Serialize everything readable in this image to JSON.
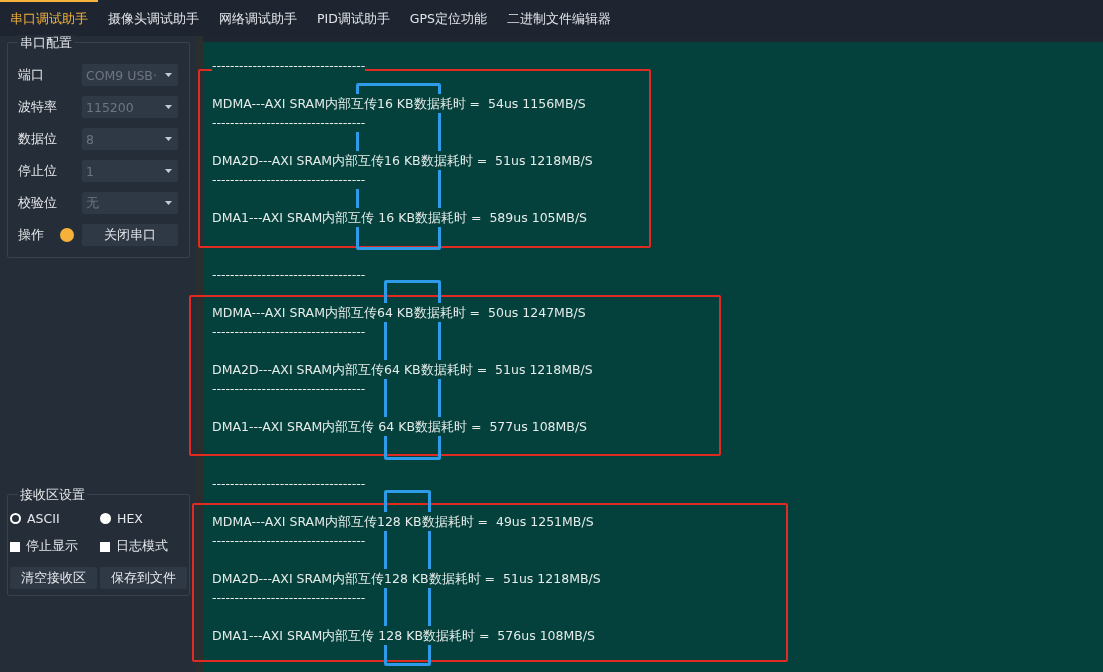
{
  "tabs": [
    {
      "label": "串口调试助手",
      "selected": true
    },
    {
      "label": "摄像头调试助手",
      "selected": false
    },
    {
      "label": "网络调试助手",
      "selected": false
    },
    {
      "label": "PID调试助手",
      "selected": false
    },
    {
      "label": "GPS定位功能",
      "selected": false
    },
    {
      "label": "二进制文件编辑器",
      "selected": false
    }
  ],
  "serial_config": {
    "title": "串口配置",
    "fields": [
      {
        "label": "端口",
        "value": "COM9 USB·",
        "disabled": true
      },
      {
        "label": "波特率",
        "value": "115200",
        "disabled": true
      },
      {
        "label": "数据位",
        "value": "8",
        "disabled": true
      },
      {
        "label": "停止位",
        "value": "1",
        "disabled": true
      },
      {
        "label": "校验位",
        "value": "无",
        "disabled": true
      }
    ],
    "operation": {
      "label": "操作",
      "connected": true,
      "button": "关闭串口"
    }
  },
  "receive_settings": {
    "title": "接收区设置",
    "modes": [
      {
        "label": "ASCII",
        "selected": true
      },
      {
        "label": "HEX",
        "selected": false
      }
    ],
    "options": [
      {
        "label": "停止显示",
        "checked": false
      },
      {
        "label": "日志模式",
        "checked": false
      }
    ],
    "buttons": [
      "清空接收区",
      "保存到文件"
    ]
  },
  "output": {
    "blocks": [
      {
        "entries": [
          {
            "separator": "----------------------------------",
            "text": "MDMA---AXI SRAM内部互传16 KB数据耗时 =  54us 1156MB/S"
          },
          {
            "separator": "----------------------------------",
            "text": "DMA2D---AXI SRAM内部互传16 KB数据耗时 =  51us 1218MB/S"
          },
          {
            "separator": "----------------------------------",
            "text": "DMA1---AXI SRAM内部互传 16 KB数据耗时 =  589us 105MB/S"
          }
        ]
      },
      {
        "entries": [
          {
            "separator": "----------------------------------",
            "text": "MDMA---AXI SRAM内部互传64 KB数据耗时 =  50us 1247MB/S"
          },
          {
            "separator": "----------------------------------",
            "text": "DMA2D---AXI SRAM内部互传64 KB数据耗时 =  51us 1218MB/S"
          },
          {
            "separator": "----------------------------------",
            "text": "DMA1---AXI SRAM内部互传 64 KB数据耗时 =  577us 108MB/S"
          }
        ]
      },
      {
        "entries": [
          {
            "separator": "----------------------------------",
            "text": "MDMA---AXI SRAM内部互传128 KB数据耗时 =  49us 1251MB/S"
          },
          {
            "separator": "----------------------------------",
            "text": "DMA2D---AXI SRAM内部互传128 KB数据耗时 =  51us 1218MB/S"
          },
          {
            "separator": "----------------------------------",
            "text": "DMA1---AXI SRAM内部互传 128 KB数据耗时 =  576us 108MB/S"
          }
        ]
      }
    ]
  }
}
